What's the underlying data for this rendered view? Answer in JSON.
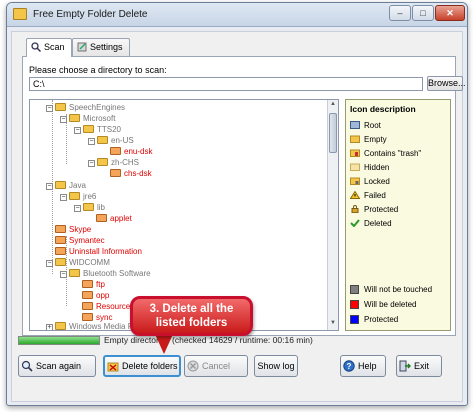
{
  "window": {
    "title": "Free Empty Folder Delete",
    "controls": {
      "minimize": "–",
      "maximize": "□",
      "close": "✕"
    }
  },
  "tabs": [
    {
      "label": "Scan",
      "icon": "magnifier-icon",
      "active": true
    },
    {
      "label": "Settings",
      "icon": "settings-icon",
      "active": false
    }
  ],
  "scan": {
    "choose_label": "Please choose a directory to scan:",
    "directory_value": "C:\\",
    "browse_label": "Browse..."
  },
  "tree": {
    "items": [
      {
        "label": "SpeechEngines",
        "color": "gray"
      },
      {
        "label": "Microsoft",
        "color": "gray"
      },
      {
        "label": "TTS20",
        "color": "gray"
      },
      {
        "label": "en-US",
        "color": "gray"
      },
      {
        "label": "enu-dsk",
        "color": "red"
      },
      {
        "label": "zh-CHS",
        "color": "gray"
      },
      {
        "label": "chs-dsk",
        "color": "red"
      },
      {
        "label": "Java",
        "color": "gray"
      },
      {
        "label": "jre6",
        "color": "gray"
      },
      {
        "label": "lib",
        "color": "gray"
      },
      {
        "label": "applet",
        "color": "red"
      },
      {
        "label": "Skype",
        "color": "red"
      },
      {
        "label": "Symantec",
        "color": "red"
      },
      {
        "label": "Uninstall Information",
        "color": "red"
      },
      {
        "label": "WIDCOMM",
        "color": "gray"
      },
      {
        "label": "Bluetooth Software",
        "color": "gray"
      },
      {
        "label": "ftp",
        "color": "red"
      },
      {
        "label": "opp",
        "color": "red"
      },
      {
        "label": "Resources",
        "color": "red"
      },
      {
        "label": "sync",
        "color": "red"
      },
      {
        "label": "Windows Media Playe",
        "color": "gray"
      }
    ]
  },
  "legend": {
    "title": "Icon description",
    "icon_items": [
      {
        "label": "Root",
        "icon": "root-icon"
      },
      {
        "label": "Empty",
        "icon": "empty-folder-icon"
      },
      {
        "label": "Contains \"trash\"",
        "icon": "trash-folder-icon"
      },
      {
        "label": "Hidden",
        "icon": "hidden-folder-icon"
      },
      {
        "label": "Locked",
        "icon": "locked-folder-icon"
      },
      {
        "label": "Failed",
        "icon": "failed-icon"
      },
      {
        "label": "Protected",
        "icon": "protected-icon"
      },
      {
        "label": "Deleted",
        "icon": "deleted-icon"
      }
    ],
    "color_items": [
      {
        "label": "Will not be touched",
        "color": "#808080"
      },
      {
        "label": "Will be deleted",
        "color": "#ff0000"
      },
      {
        "label": "Protected",
        "color": "#0000ff"
      }
    ]
  },
  "status": {
    "progress": 1.0,
    "text_visible": "Empty directories (checked 14629 / runtime: 00:16 min)"
  },
  "buttons": {
    "scan_again": "Scan again",
    "delete_folders": "Delete folders",
    "cancel": "Cancel",
    "show_log": "Show log",
    "help": "Help",
    "exit": "Exit"
  },
  "callout": {
    "line1": "3. Delete all the",
    "line2": "listed folders"
  },
  "colors": {
    "red_text": "#e00000",
    "gray_text": "#777777",
    "accent": "#3d8fd0"
  }
}
